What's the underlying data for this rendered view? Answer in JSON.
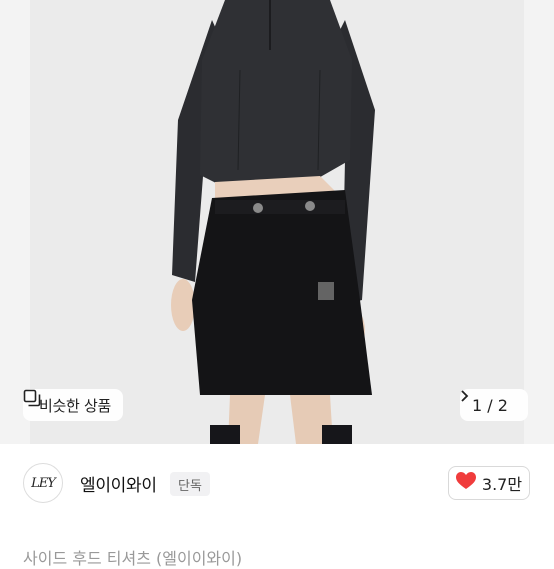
{
  "image": {
    "alt_subject": "model wearing black cropped top and black cargo mini skirt"
  },
  "similar_products": {
    "label": "비슷한 상품",
    "icon": "similar-products-icon"
  },
  "pager": {
    "text": "1 / 2",
    "icon": "chevron-right-icon"
  },
  "seller": {
    "logo_text": "LEY",
    "name": "엘이이와이",
    "badge": "단독"
  },
  "like": {
    "icon": "heart-icon",
    "count": "3.7만",
    "color": "#f03c3c"
  },
  "product": {
    "title": "사이드 후드 티셔츠 (엘이이와이)"
  }
}
